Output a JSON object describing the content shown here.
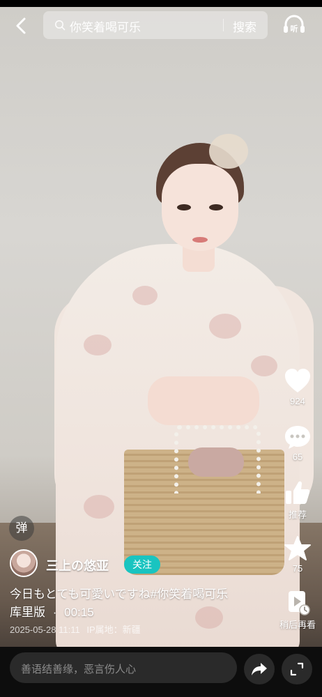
{
  "search": {
    "query": "你笑着喝可乐",
    "button_label": "搜索"
  },
  "listen": {
    "label": "听"
  },
  "rail": {
    "like_count": "924",
    "comment_count": "65",
    "recommend_label": "推荐",
    "favorite_count": "75",
    "watch_later_label": "稍后再看"
  },
  "danmu": {
    "label": "弹"
  },
  "author": {
    "name": "三上の悠亚",
    "follow_label": "关注"
  },
  "post": {
    "caption_line1": "今日もとても可愛いですね#你笑着喝可乐",
    "caption_line2": "库里版",
    "duration_sep": "·",
    "duration": "00:15",
    "date": "2025-05-28 11:11",
    "ip_label": "IP属地：新疆"
  },
  "bottom": {
    "comment_placeholder": "善语结善缘，恶言伤人心",
    "page_count": 5,
    "active_page": 2
  },
  "colors": {
    "follow_bg": "#19c4c0",
    "bottom_bg": "#0d0d0d"
  }
}
